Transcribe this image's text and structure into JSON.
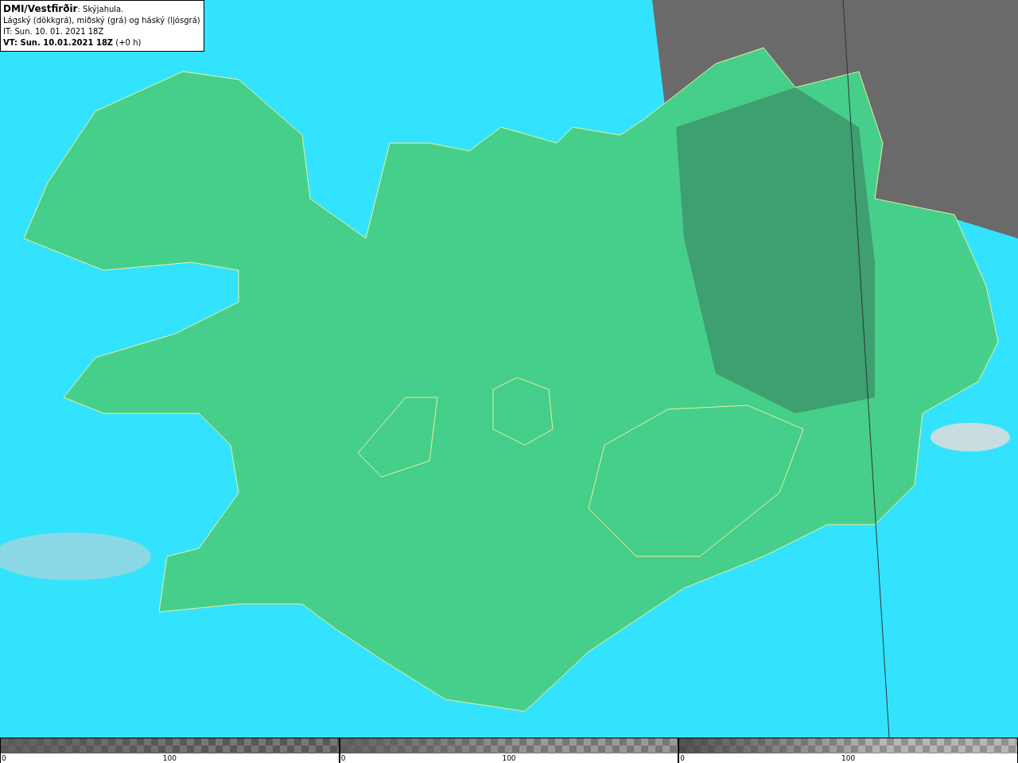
{
  "legend": {
    "title": "**DMI/Vestfirðir**: Skýjahula.",
    "description": "Lágský (dökkgrá), miðský (grá) og háský (ljósgrá)",
    "issue_time": "IT: Sun. 10. 01. 2021 18Z",
    "valid_time": "**VT: Sun. 10.01.2021 18Z** (+0 h)"
  },
  "scales": [
    {
      "kind": "low",
      "min": "0",
      "mid": "100"
    },
    {
      "kind": "mid",
      "min": "0",
      "mid": "100"
    },
    {
      "kind": "high",
      "min": "0",
      "mid": "100"
    }
  ]
}
